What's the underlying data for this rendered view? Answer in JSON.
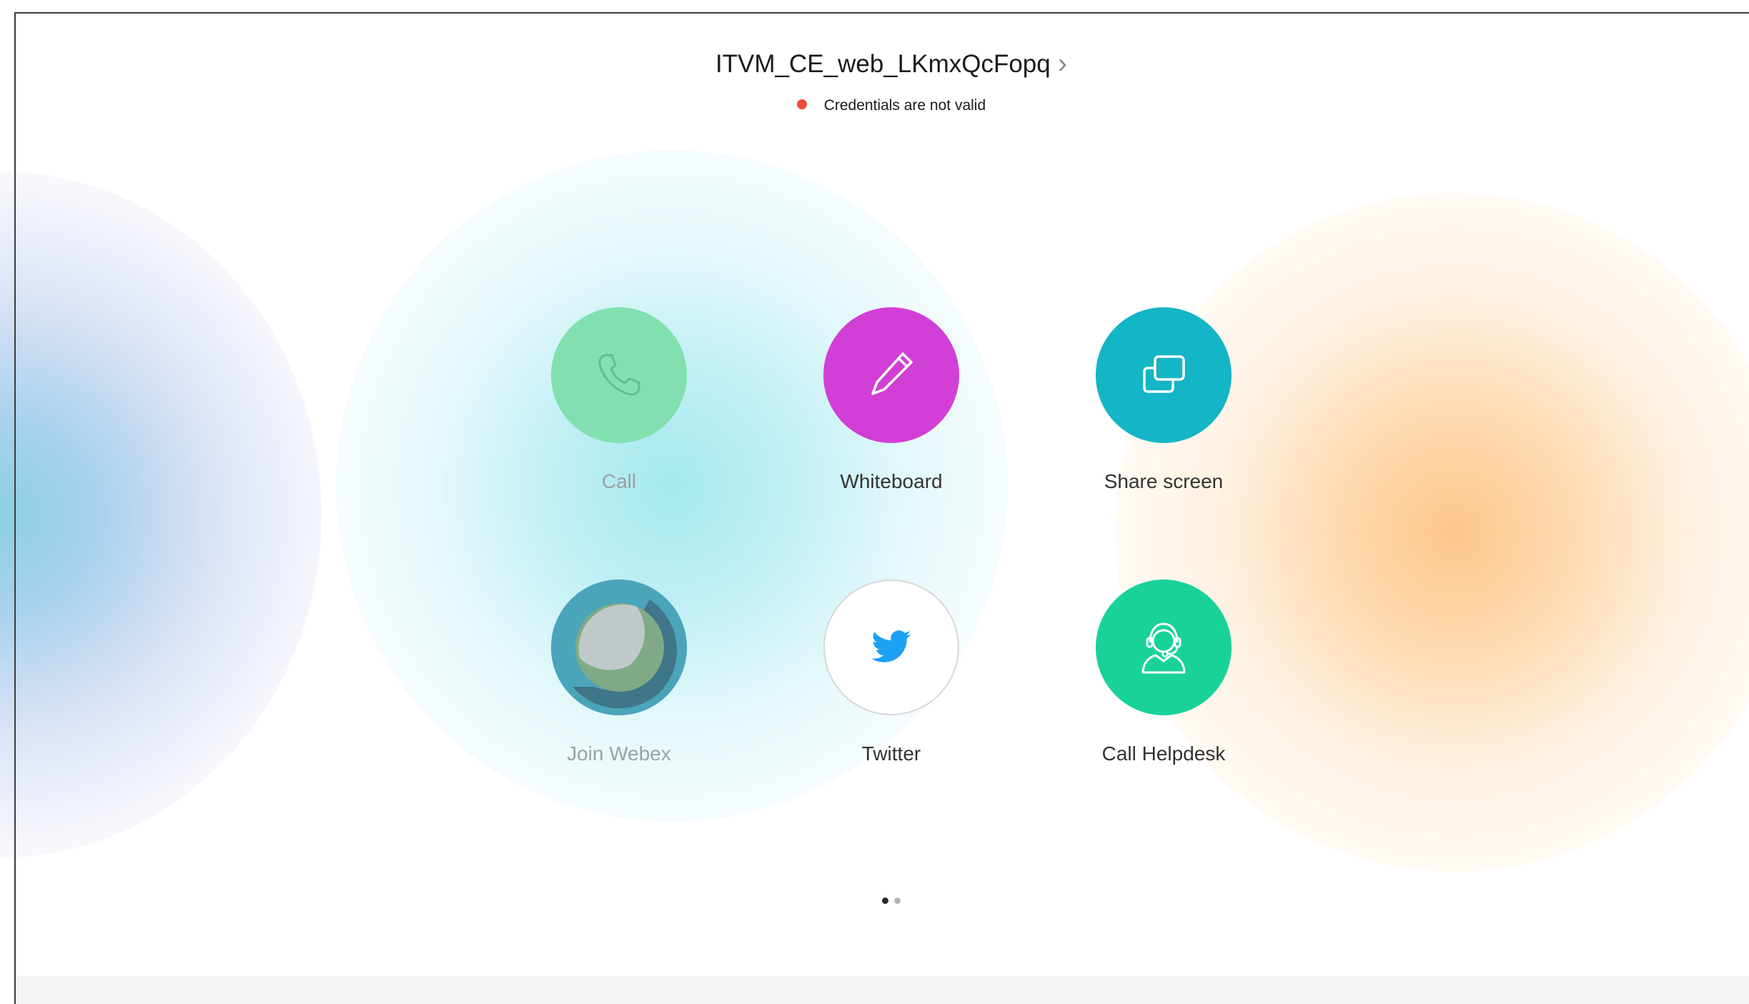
{
  "header": {
    "device_name": "ITVM_CE_web_LKmxQcFopq",
    "chevron": "›"
  },
  "status": {
    "text": "Credentials are not valid",
    "color": "#ee4b3a"
  },
  "tiles": [
    {
      "label": "Call",
      "icon": "phone-icon",
      "color": "#82e0b0",
      "enabled": false
    },
    {
      "label": "Whiteboard",
      "icon": "pencil-icon",
      "color": "#d23fd6",
      "enabled": true
    },
    {
      "label": "Share screen",
      "icon": "share-screen-icon",
      "color": "#14b5c6",
      "enabled": true
    },
    {
      "label": "Join Webex",
      "icon": "webex-icon",
      "color": "#4aa4ba",
      "enabled": false
    },
    {
      "label": "Twitter",
      "icon": "twitter-bird-icon",
      "color": "#1da1f2",
      "enabled": true
    },
    {
      "label": "Call Helpdesk",
      "icon": "headset-agent-icon",
      "color": "#18d29a",
      "enabled": true
    }
  ],
  "pagination": {
    "total": 2,
    "current": 1
  }
}
